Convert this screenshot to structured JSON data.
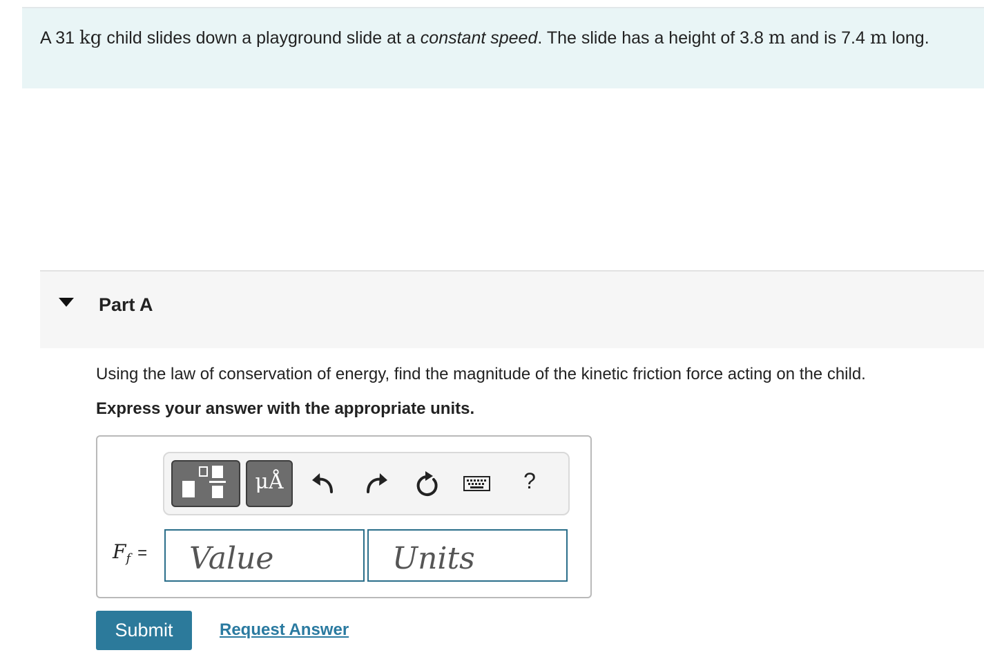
{
  "problem": {
    "text_1": "A 31 ",
    "mass_unit": "kg",
    "text_2": " child slides down a playground slide at a ",
    "emphasis": "constant speed",
    "text_3": ". The slide has a height of 3.8 ",
    "height_unit": "m",
    "text_4": " and is 7.4 ",
    "length_unit": "m",
    "text_5": " long."
  },
  "part": {
    "title": "Part A",
    "question": "Using the law of conservation of energy, find the magnitude of the kinetic friction force acting on the child.",
    "instruction": "Express your answer with the appropriate units."
  },
  "toolbar": {
    "units_label": "μÅ",
    "help_label": "?",
    "icons": [
      "templates-icon",
      "units-icon",
      "undo-icon",
      "redo-icon",
      "reset-icon",
      "keyboard-icon",
      "help-icon"
    ]
  },
  "answer": {
    "variable": "F",
    "subscript": "f",
    "equals": "=",
    "value_placeholder": "Value",
    "units_placeholder": "Units"
  },
  "actions": {
    "submit_label": "Submit",
    "request_label": "Request Answer"
  },
  "colors": {
    "problem_bg": "#e9f5f6",
    "part_bg": "#f6f6f6",
    "accent": "#2c7a9b",
    "link": "#2a7aa0",
    "field_border": "#2a6e8a"
  }
}
